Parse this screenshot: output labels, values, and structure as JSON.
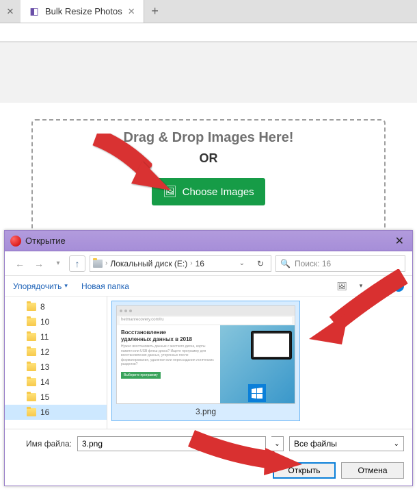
{
  "browser": {
    "tab_title": "Bulk Resize Photos"
  },
  "drop_zone": {
    "title": "Drag & Drop Images Here!",
    "or": "OR",
    "choose_button": "Choose Images"
  },
  "dialog": {
    "title": "Открытие",
    "breadcrumb": {
      "disk": "Локальный диск (E:)",
      "folder": "16"
    },
    "search_placeholder": "Поиск: 16",
    "toolbar": {
      "organize": "Упорядочить",
      "new_folder": "Новая папка"
    },
    "folders": [
      "8",
      "10",
      "11",
      "12",
      "13",
      "14",
      "15",
      "16"
    ],
    "selected_folder": "16",
    "thumbnail": {
      "filename": "3.png",
      "content_line1": "Восстановление",
      "content_line2": "удаленных данных в 2018"
    },
    "filename_label": "Имя файла:",
    "filename_value": "3.png",
    "filetype": "Все файлы",
    "open_button": "Открыть",
    "cancel_button": "Отмена"
  }
}
